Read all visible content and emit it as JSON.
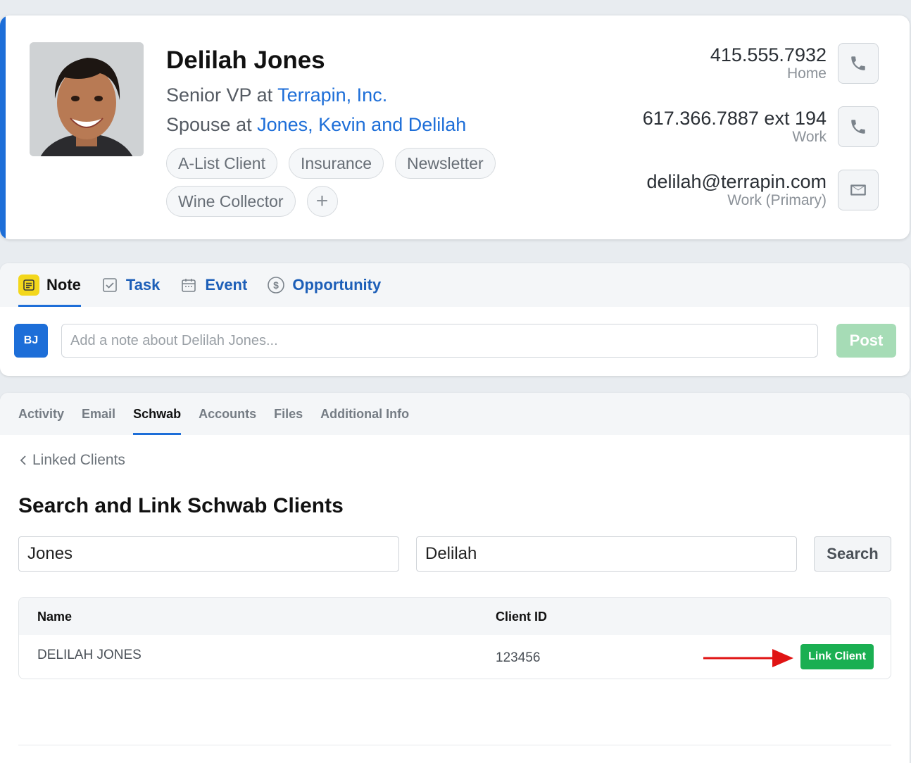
{
  "contact": {
    "name": "Delilah Jones",
    "role1_prefix": "Senior VP at ",
    "role1_link": "Terrapin, Inc.",
    "role2_prefix": "Spouse at ",
    "role2_link": "Jones, Kevin and Delilah",
    "tags": [
      "A-List Client",
      "Insurance",
      "Newsletter",
      "Wine Collector"
    ],
    "tag_add_symbol": "+",
    "phone_home": "415.555.7932",
    "phone_home_label": "Home",
    "phone_work": "617.366.7887 ext 194",
    "phone_work_label": "Work",
    "email": "delilah@terrapin.com",
    "email_label": "Work (Primary)"
  },
  "composer": {
    "tabs": {
      "note": "Note",
      "task": "Task",
      "event": "Event",
      "opportunity": "Opportunity"
    },
    "user_initials": "BJ",
    "placeholder": "Add a note about Delilah Jones...",
    "post_label": "Post"
  },
  "detail": {
    "tabs": {
      "activity": "Activity",
      "email": "Email",
      "schwab": "Schwab",
      "accounts": "Accounts",
      "files": "Files",
      "additional": "Additional Info"
    },
    "back_link": "Linked Clients",
    "title": "Search and Link Schwab Clients",
    "last_name_value": "Jones",
    "first_name_value": "Delilah",
    "search_label": "Search",
    "columns": {
      "name": "Name",
      "client_id": "Client ID"
    },
    "rows": [
      {
        "name": "DELILAH JONES",
        "client_id": "123456",
        "action": "Link Client"
      }
    ]
  },
  "colors": {
    "accent": "#1d6ed8",
    "link_client_green": "#1aaf52",
    "post_disabled": "#a6dcb6",
    "annotation_arrow": "#e01414"
  }
}
